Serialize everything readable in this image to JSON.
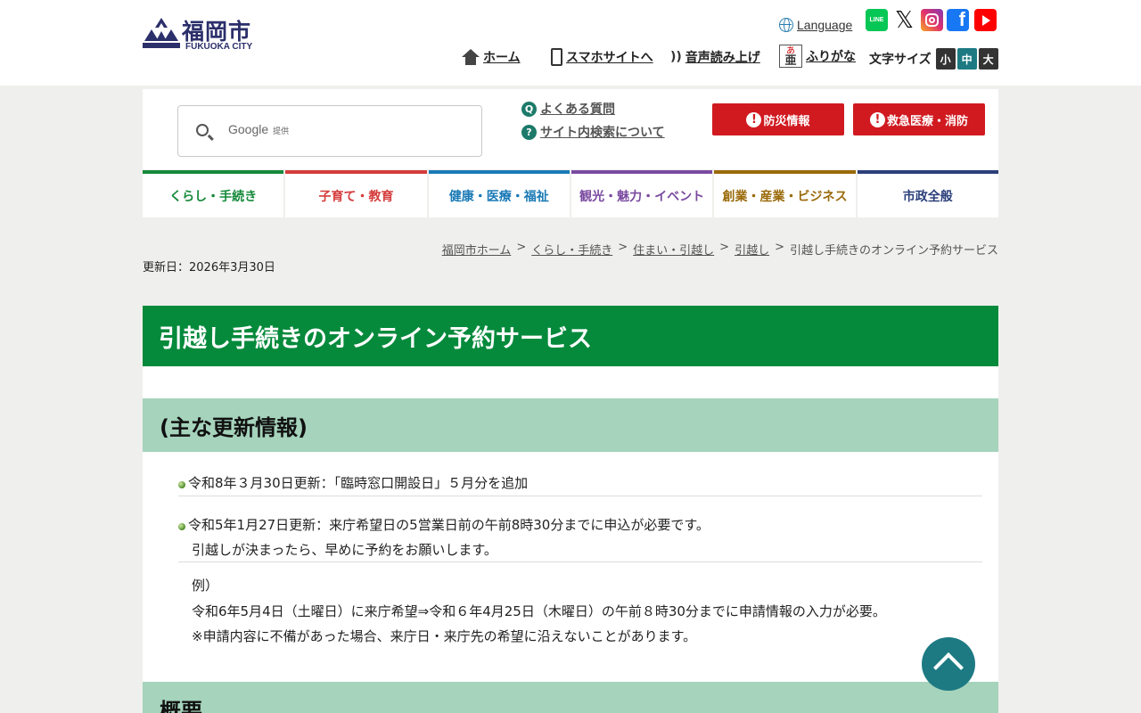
{
  "header": {
    "logo_jp": "福岡市",
    "logo_en": "FUKUOKA CITY",
    "language_label": "Language",
    "sns": {
      "line_label": "LINE",
      "x_label": "𝕏",
      "facebook_label": "f"
    },
    "util": {
      "home": "ホーム",
      "smartphone": "スマホサイトへ",
      "voice": "音声読み上げ",
      "voice_icon": "))",
      "furigana": "ふりがな",
      "furigana_icon_top": "あ",
      "furigana_icon_bottom": "亜"
    },
    "font_size": {
      "label": "文字サイズ",
      "small": "小",
      "medium": "中",
      "large": "大"
    }
  },
  "search": {
    "provider_label": "Google",
    "provider_suffix": "提供",
    "faq_icon": "Q",
    "faq": "よくある質問",
    "help_icon": "?",
    "help": "サイト内検索について",
    "alert_icon": "!",
    "disaster": "防災情報",
    "emergency": "救急医療・消防"
  },
  "nav": {
    "items": [
      {
        "label": "くらし・手続き",
        "color": "#15893a"
      },
      {
        "label": "子育て・教育",
        "color": "#d63c3c"
      },
      {
        "label": "健康・医療・福祉",
        "color": "#1a7ab6"
      },
      {
        "label": "観光・魅力・イベント",
        "color": "#7a4aa0"
      },
      {
        "label": "創業・産業・ビジネス",
        "color": "#9a6a0a"
      },
      {
        "label": "市政全般",
        "color": "#2b3f7a"
      }
    ]
  },
  "breadcrumb": {
    "items": [
      "福岡市ホーム",
      "くらし・手続き",
      "住まい・引越し",
      "引越し"
    ],
    "current": "引越し手続きのオンライン予約サービス",
    "separator": ">"
  },
  "updated": "更新日：2026年3月30日",
  "main": {
    "title": "引越し手続きのオンライン予約サービス",
    "section1": "(主な更新情報)",
    "news1": "令和8年３月30日更新：「臨時窓口開設日」５月分を追加",
    "news2_line1": "令和5年1月27日更新：来庁希望日の5営業日前の午前8時30分までに申込が必要です。",
    "news2_line2": "引越しが決まったら、早めに予約をお願いします。",
    "example_label": "例）",
    "example_line1": "令和6年5月4日（土曜日）に来庁希望⇒令和６年4月25日（木曜日）の午前８時30分までに申請情報の入力が必要。",
    "example_line2": "※申請内容に不備があった場合、来庁日・来庁先の希望に沿えないことがあります。",
    "section2": "概要"
  },
  "colors": {
    "brand_navy": "#2b2f6a",
    "title_green": "#058a3b",
    "section_green": "#a5d3bb",
    "alert_red": "#d01a20",
    "accent_teal": "#1d7a83"
  }
}
